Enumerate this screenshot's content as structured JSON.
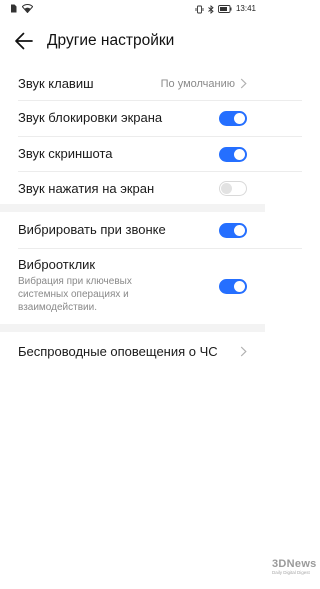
{
  "status_bar": {
    "time": "13:41",
    "icons": [
      "sim-icon",
      "wifi-icon",
      "vibrate-icon",
      "bluetooth-icon",
      "battery-icon"
    ]
  },
  "header": {
    "title": "Другие настройки",
    "back_icon": "arrow-left-icon"
  },
  "settings": {
    "key_sound": {
      "label": "Звук клавиш",
      "value": "По умолчанию"
    },
    "lock_sound": {
      "label": "Звук блокировки экрана",
      "enabled": true
    },
    "screenshot_sound": {
      "label": "Звук скриншота",
      "enabled": true
    },
    "touch_sound": {
      "label": "Звук нажатия на экран",
      "enabled": false
    },
    "vibrate_on_ring": {
      "label": "Вибрировать при звонке",
      "enabled": true
    },
    "haptic": {
      "label": "Виброотклик",
      "description": "Вибрация при ключевых системных операциях и взаимодействии.",
      "enabled": true
    },
    "emergency_alerts": {
      "label": "Беспроводные оповещения о ЧС"
    }
  },
  "watermark": {
    "text": "3DNews",
    "subtitle": "Daily Digital Digest"
  },
  "colors": {
    "accent": "#256fff",
    "toggle_off": "#e2e2e2",
    "secondary_text": "#8a8a8a"
  }
}
